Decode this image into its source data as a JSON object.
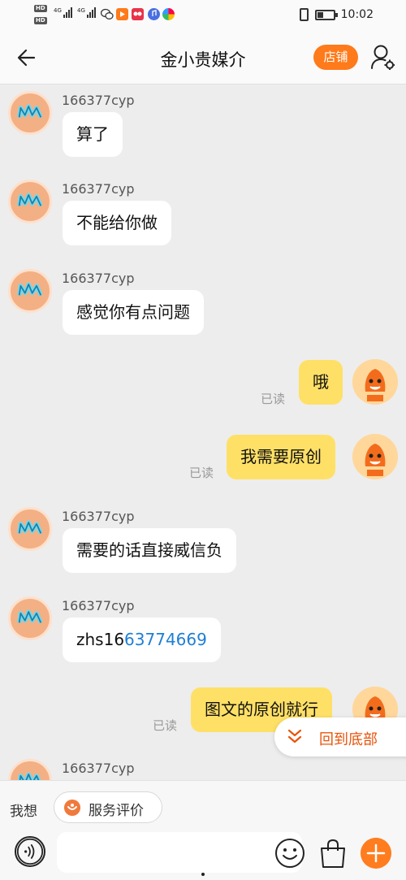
{
  "status_bar": {
    "time": "10:02",
    "network_1": "4G",
    "network_2": "4G",
    "hd_1": "HD",
    "hd_2": "HD"
  },
  "header": {
    "title": "金小贵媒介",
    "shop_button": "店铺",
    "icons": [
      "back-arrow-icon",
      "user-settings-icon"
    ]
  },
  "messages": [
    {
      "side": "left",
      "sender": "166377cyp",
      "text": "算了"
    },
    {
      "side": "left",
      "sender": "166377cyp",
      "text": "不能给你做"
    },
    {
      "side": "left",
      "sender": "166377cyp",
      "text": "感觉你有点问题"
    },
    {
      "side": "right",
      "text": "哦",
      "status": "已读"
    },
    {
      "side": "right",
      "text": "我需要原创",
      "status": "已读"
    },
    {
      "side": "left",
      "sender": "166377cyp",
      "text": "需要的话直接威信负"
    },
    {
      "side": "left",
      "sender": "166377cyp",
      "text_prefix": "zhs16",
      "text_link": "63774669"
    },
    {
      "side": "right",
      "text": "图文的原创就行",
      "status": "已读"
    },
    {
      "side": "left",
      "sender": "166377cyp",
      "text": ""
    }
  ],
  "back_to_bottom": "回到底部",
  "toolbar": {
    "label": "我想",
    "service_button": "服务评价",
    "input_placeholder": "",
    "icons": [
      "voice-icon",
      "emoji-icon",
      "shopping-bag-icon",
      "plus-icon"
    ]
  },
  "colors": {
    "accent": "#ff7a1a",
    "own_bubble": "#ffe066",
    "link": "#1e7fd6",
    "background": "#ededed"
  }
}
